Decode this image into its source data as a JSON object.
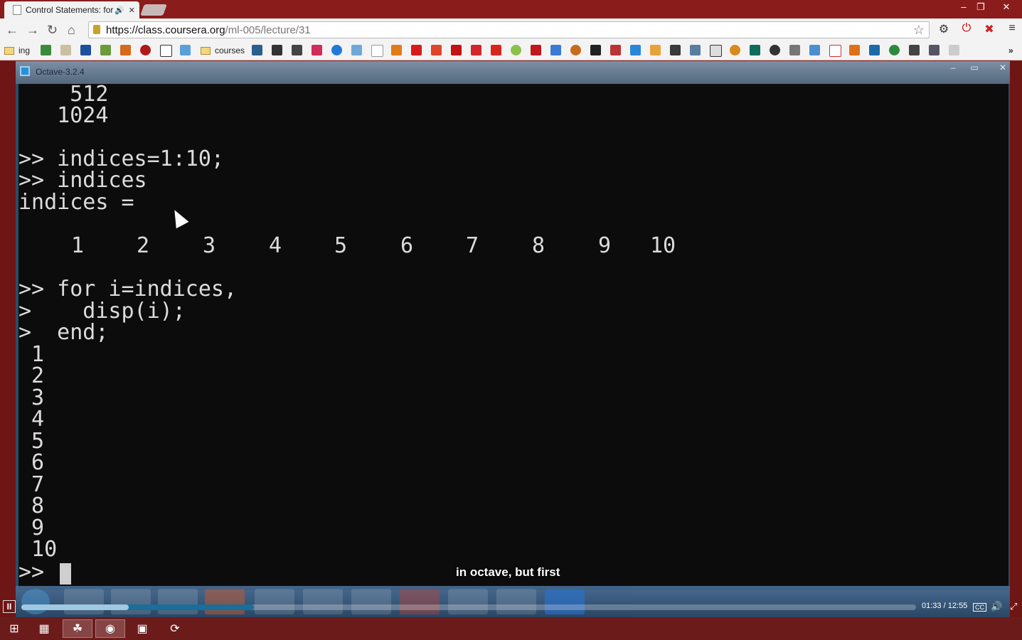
{
  "browser": {
    "tab_title": "Control Statements: for",
    "tab_audio_icon": "speaker-icon",
    "url_host": "https://class.coursera.org",
    "url_path": "/ml-005/lecture/31",
    "bookmarks": [
      {
        "label": "ing",
        "type": "folder"
      },
      {
        "label": "courses",
        "type": "folder"
      }
    ],
    "bookmark_more": "»"
  },
  "octave": {
    "title": "Octave-3.2.4",
    "console_lines": [
      "    512",
      "   1024",
      "",
      ">> indices=1:10;",
      ">> indices",
      "indices =",
      "",
      "",
      "",
      ">> for i=indices,",
      ">    disp(i);",
      ">  end;",
      " 1",
      " 2",
      " 3",
      " 4",
      " 5",
      " 6",
      " 7",
      " 8",
      " 9",
      " 10",
      ">>"
    ],
    "indices_values": [
      "1",
      "2",
      "3",
      "4",
      "5",
      "6",
      "7",
      "8",
      "9",
      "10"
    ]
  },
  "video": {
    "caption": "in octave, but first",
    "time": "01:33 / 12:55",
    "played_fraction": 0.12,
    "buffered_fraction": 0.26,
    "cc_label": "CC"
  },
  "colors": {
    "chrome_frame": "#8a1c1c",
    "console_bg": "#0c0c0c",
    "console_fg": "#dcdcdc",
    "progress_played": "#9fc8e2",
    "progress_buffer": "#1b6d9a"
  }
}
